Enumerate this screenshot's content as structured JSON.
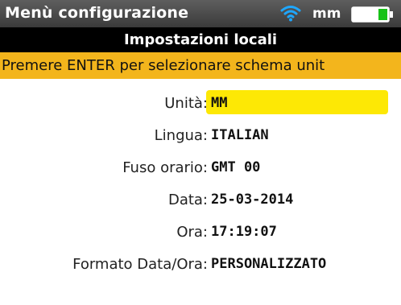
{
  "status_bar": {
    "title": "Menù configurazione",
    "units": "mm",
    "wifi_icon": "wifi-icon",
    "battery_icon": "battery-icon",
    "wifi_color": "#1ea7ff",
    "battery_color": "#18c218"
  },
  "section": {
    "title": "Impostazioni locali"
  },
  "hint": {
    "text": "Premere ENTER per selezionare schema unit"
  },
  "settings": [
    {
      "label": "Unità:",
      "value": "MM",
      "selected": true
    },
    {
      "label": "Lingua:",
      "value": "ITALIAN",
      "selected": false
    },
    {
      "label": "Fuso orario:",
      "value": "GMT 00",
      "selected": false
    },
    {
      "label": "Data:",
      "value": "25-03-2014",
      "selected": false
    },
    {
      "label": "Ora:",
      "value": "17:19:07",
      "selected": false
    },
    {
      "label": "Formato Data/Ora:",
      "value": "PERSONALIZZATO",
      "selected": false
    }
  ],
  "colors": {
    "hint_bg": "#f3b51c",
    "selection_bg": "#fde805"
  }
}
